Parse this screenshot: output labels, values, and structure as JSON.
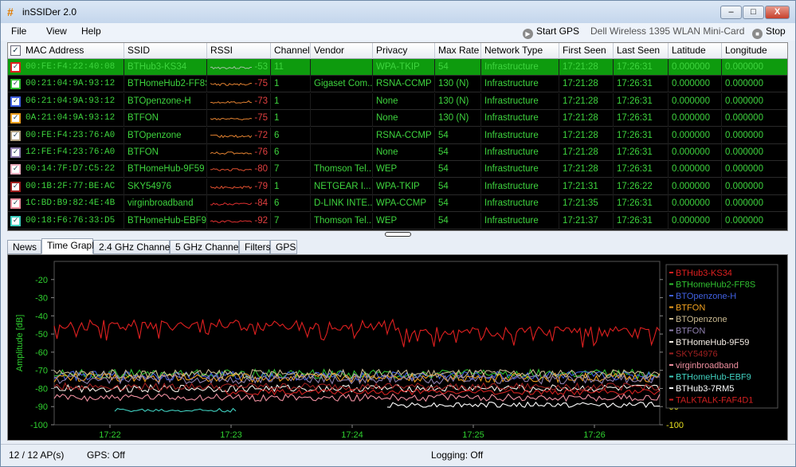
{
  "window": {
    "title": "inSSIDer 2.0",
    "icon": "hash-icon",
    "min_label": "–",
    "max_label": "□",
    "close_label": "X"
  },
  "menu": {
    "items": [
      "File",
      "View",
      "Help"
    ],
    "start_gps": "Start GPS",
    "adapter": "Dell Wireless 1395 WLAN Mini-Card",
    "stop": "Stop"
  },
  "table": {
    "columns": [
      "MAC Address",
      "SSID",
      "RSSI",
      "Channel",
      "Vendor",
      "Privacy",
      "Max Rate",
      "Network Type",
      "First Seen",
      "Last Seen",
      "Latitude",
      "Longitude"
    ],
    "rows": [
      {
        "mac": "00:FE:F4:22:40:08",
        "ssid": "BTHub3-KS34",
        "rssi": "-53",
        "channel": "11",
        "vendor": "",
        "privacy": "WPA-TKIP",
        "rate": "54",
        "type": "Infrastructure",
        "first": "17:21:28",
        "last": "17:26:31",
        "lat": "0.000000",
        "lon": "0.000000",
        "color": "#e02020",
        "spark": "#a0c0a0",
        "selected": true
      },
      {
        "mac": "00:21:04:9A:93:12",
        "ssid": "BTHomeHub2-FF8S",
        "rssi": "-75",
        "channel": "1",
        "vendor": "Gigaset Com...",
        "privacy": "RSNA-CCMP",
        "rate": "130 (N)",
        "type": "Infrastructure",
        "first": "17:21:28",
        "last": "17:26:31",
        "lat": "0.000000",
        "lon": "0.000000",
        "color": "#30c030",
        "spark": "#e08030",
        "selected": false
      },
      {
        "mac": "06:21:04:9A:93:12",
        "ssid": "BTOpenzone-H",
        "rssi": "-73",
        "channel": "1",
        "vendor": "",
        "privacy": "None",
        "rate": "130 (N)",
        "type": "Infrastructure",
        "first": "17:21:28",
        "last": "17:26:31",
        "lat": "0.000000",
        "lon": "0.000000",
        "color": "#4060e0",
        "spark": "#e08030",
        "selected": false
      },
      {
        "mac": "0A:21:04:9A:93:12",
        "ssid": "BTFON",
        "rssi": "-75",
        "channel": "1",
        "vendor": "",
        "privacy": "None",
        "rate": "130 (N)",
        "type": "Infrastructure",
        "first": "17:21:28",
        "last": "17:26:31",
        "lat": "0.000000",
        "lon": "0.000000",
        "color": "#f0a020",
        "spark": "#e08030",
        "selected": false
      },
      {
        "mac": "00:FE:F4:23:76:A0",
        "ssid": "BTOpenzone",
        "rssi": "-72",
        "channel": "6",
        "vendor": "",
        "privacy": "RSNA-CCMP",
        "rate": "54",
        "type": "Infrastructure",
        "first": "17:21:28",
        "last": "17:26:31",
        "lat": "0.000000",
        "lon": "0.000000",
        "color": "#b0a080",
        "spark": "#e08030",
        "selected": false
      },
      {
        "mac": "12:FE:F4:23:76:A0",
        "ssid": "BTFON",
        "rssi": "-76",
        "channel": "6",
        "vendor": "",
        "privacy": "None",
        "rate": "54",
        "type": "Infrastructure",
        "first": "17:21:28",
        "last": "17:26:31",
        "lat": "0.000000",
        "lon": "0.000000",
        "color": "#9080b0",
        "spark": "#e08030",
        "selected": false
      },
      {
        "mac": "00:14:7F:D7:C5:22",
        "ssid": "BTHomeHub-9F59",
        "rssi": "-80",
        "channel": "7",
        "vendor": "Thomson Tel...",
        "privacy": "WEP",
        "rate": "54",
        "type": "Infrastructure",
        "first": "17:21:28",
        "last": "17:26:31",
        "lat": "0.000000",
        "lon": "0.000000",
        "color": "#f0b0c0",
        "spark": "#e05030",
        "selected": false
      },
      {
        "mac": "00:1B:2F:77:BE:AC",
        "ssid": "SKY54976",
        "rssi": "-79",
        "channel": "1",
        "vendor": "NETGEAR I...",
        "privacy": "WPA-TKIP",
        "rate": "54",
        "type": "Infrastructure",
        "first": "17:21:31",
        "last": "17:26:22",
        "lat": "0.000000",
        "lon": "0.000000",
        "color": "#a02020",
        "spark": "#e05030",
        "selected": false
      },
      {
        "mac": "1C:BD:B9:82:4E:4B",
        "ssid": "virginbroadband",
        "rssi": "-84",
        "channel": "6",
        "vendor": "D-LINK INTE...",
        "privacy": "WPA-CCMP",
        "rate": "54",
        "type": "Infrastructure",
        "first": "17:21:35",
        "last": "17:26:31",
        "lat": "0.000000",
        "lon": "0.000000",
        "color": "#f090a0",
        "spark": "#e03030",
        "selected": false
      },
      {
        "mac": "00:18:F6:76:33:D5",
        "ssid": "BTHomeHub-EBF9",
        "rssi": "-92",
        "channel": "7",
        "vendor": "Thomson Tel...",
        "privacy": "WEP",
        "rate": "54",
        "type": "Infrastructure",
        "first": "17:21:37",
        "last": "17:26:31",
        "lat": "0.000000",
        "lon": "0.000000",
        "color": "#40d0c0",
        "spark": "#e03030",
        "selected": false
      }
    ]
  },
  "tabs": [
    "News",
    "Time Graph",
    "2.4 GHz Channels",
    "5 GHz Channels",
    "Filters",
    "GPS"
  ],
  "active_tab": 1,
  "chart_data": {
    "type": "line",
    "ylabel": "Amplitude [dB]",
    "ylim": [
      -100,
      -10
    ],
    "yticks": [
      -20,
      -30,
      -40,
      -50,
      -60,
      -70,
      -80,
      -90,
      -100
    ],
    "xticks": [
      "17:22",
      "17:23",
      "17:24",
      "17:25",
      "17:26"
    ],
    "legend_position": "right",
    "series": [
      {
        "name": "BTHub3-KS34",
        "color": "#e02020",
        "mean": -45,
        "jitter": 3
      },
      {
        "name": "BTHomeHub2-FF8S",
        "color": "#30c030",
        "mean": -72,
        "jitter": 2.5
      },
      {
        "name": "BTOpenzone-H",
        "color": "#4060e0",
        "mean": -73,
        "jitter": 2.5
      },
      {
        "name": "BTFON",
        "color": "#f0a020",
        "mean": -74,
        "jitter": 2.5
      },
      {
        "name": "BTOpenzone",
        "color": "#c8b890",
        "mean": -72,
        "jitter": 2.5
      },
      {
        "name": "BTFON",
        "color": "#9080b0",
        "mean": -75,
        "jitter": 2.5
      },
      {
        "name": "BTHomeHub-9F59",
        "color": "#f8f0e8",
        "mean": -80,
        "jitter": 2
      },
      {
        "name": "SKY54976",
        "color": "#a02020",
        "mean": -79,
        "jitter": 2
      },
      {
        "name": "virginbroadband",
        "color": "#f090a0",
        "mean": -85,
        "jitter": 2
      },
      {
        "name": "BTHomeHub-EBF9",
        "color": "#40d0c0",
        "mean": -92,
        "jitter": 1
      },
      {
        "name": "BTHub3-7RM5",
        "color": "#ffffff",
        "mean": -89,
        "jitter": 1.5
      },
      {
        "name": "TALKTALK-FAF4D1",
        "color": "#d02020",
        "mean": -82,
        "jitter": 1.5
      }
    ]
  },
  "status": {
    "ap_count": "12 / 12 AP(s)",
    "gps": "GPS: Off",
    "logging": "Logging: Off"
  }
}
